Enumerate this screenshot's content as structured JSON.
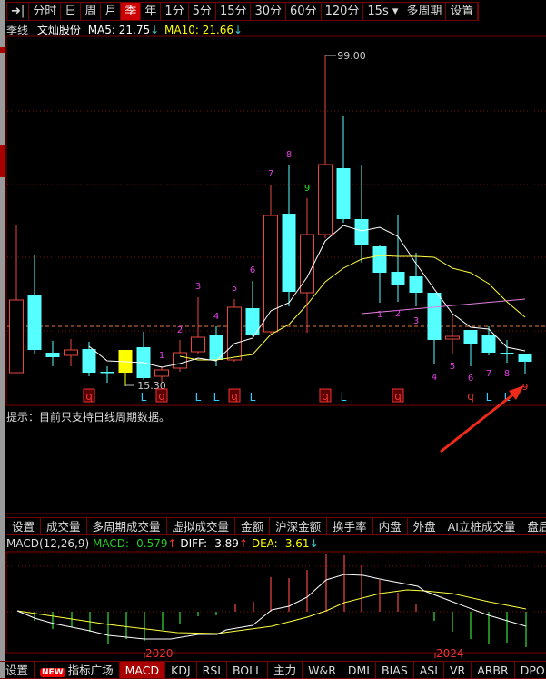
{
  "toolbar": {
    "items": [
      "分时",
      "日",
      "周",
      "月",
      "季",
      "年",
      "1分",
      "5分",
      "15分",
      "30分",
      "60分",
      "120分",
      "15s ▾",
      "多周期",
      "设置"
    ],
    "active": "季"
  },
  "title": {
    "period": "季线",
    "stock": "文灿股份",
    "ma5_label": "MA5: 21.75",
    "ma5_arrow": "↓",
    "ma10_label": "MA10: 21.66",
    "ma10_arrow": "↓"
  },
  "chart": {
    "high_label": "99.00",
    "low_label": "15.30",
    "count_labels_up": [
      "1",
      "2",
      "3",
      "4",
      "5",
      "6",
      "7",
      "8",
      "9"
    ],
    "count_labels_down": [
      "1",
      "2",
      "3",
      "4",
      "5",
      "6",
      "7",
      "8",
      "9"
    ],
    "markers": [
      "q",
      "L",
      "q",
      "L",
      "L",
      "q",
      "L",
      "q",
      "L",
      "q",
      "q",
      "L",
      "L"
    ]
  },
  "hint": "提示：目前只支持日线周期数据。",
  "indicator_tabs": [
    "设置",
    "成交量",
    "多周期成交量",
    "虚拟成交量",
    "金额",
    "沪深金额",
    "换手率",
    "内盘",
    "外盘",
    "AI立桩成交量",
    "盘后成"
  ],
  "macd": {
    "name": "MACD(12,26,9)",
    "macd": "MACD: -0.579",
    "macd_arrow": "↑",
    "diff": "DIFF: -3.89",
    "diff_arrow": "↑",
    "dea": "DEA: -3.61",
    "dea_arrow": "↓"
  },
  "axis": {
    "years": [
      "2020",
      "2024"
    ]
  },
  "bottom_tabs": {
    "new_badge": "NEW",
    "items": [
      "设置",
      "指标广场",
      "MACD",
      "KDJ",
      "RSI",
      "BOLL",
      "主力",
      "W&R",
      "DMI",
      "BIAS",
      "ASI",
      "VR",
      "ARBR",
      "DPO"
    ],
    "active": "MACD"
  },
  "colors": {
    "up": "#e8473f",
    "down": "#55ffff",
    "ma5": "#ffffff",
    "ma10": "#ffff40",
    "count": "#e040e0",
    "accent": "#cc0000"
  }
}
